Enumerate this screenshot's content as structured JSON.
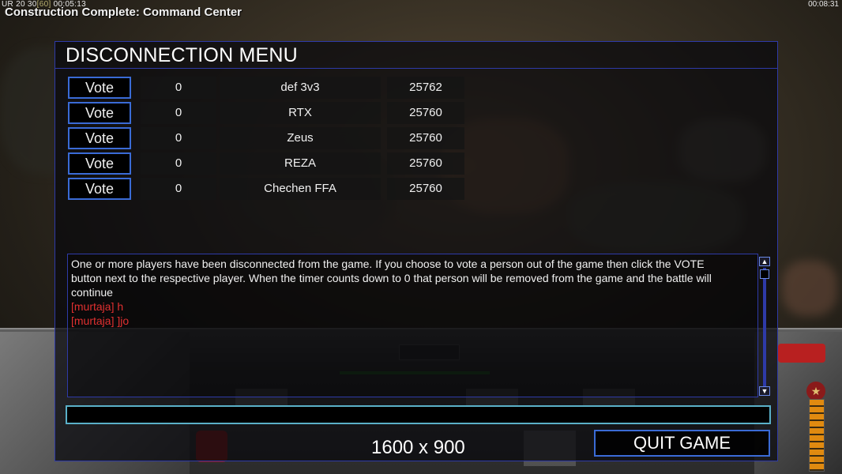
{
  "hud": {
    "stats_prefix": "UR 20 30",
    "stats_bracket": "[60]",
    "stats_time": "00:05:13",
    "notification": "Construction Complete: Command Center",
    "clock": "00:08:31"
  },
  "menu": {
    "title": "DISCONNECTION MENU",
    "vote_label": "Vote",
    "players": [
      {
        "count": "0",
        "name": "def 3v3",
        "port": "25762"
      },
      {
        "count": "0",
        "name": "RTX",
        "port": "25760"
      },
      {
        "count": "0",
        "name": "Zeus",
        "port": "25760"
      },
      {
        "count": "0",
        "name": "REZA",
        "port": "25760"
      },
      {
        "count": "0",
        "name": "Chechen FFA",
        "port": "25760"
      }
    ],
    "info_line1": "One or more players have been disconnected from the game. If you choose to vote a person out of the game then click the VOTE",
    "info_line2": " button next to the respective player. When the timer counts down to 0 that person will be removed from the game and the battle will",
    "info_line3": "continue",
    "messages": [
      "[murtaja] h",
      "[murtaja] ]jo"
    ],
    "chat_input_value": "",
    "resolution": "1600 x 900",
    "quit_label": "QUIT GAME"
  },
  "colors": {
    "panel_border": "#2e3aa8",
    "button_border": "#3a6bd6",
    "input_border": "#5ab0c8",
    "chat_message": "#e03030"
  },
  "icons": {
    "scroll_up": "triangle-up-icon",
    "scroll_down": "triangle-down-icon",
    "rank": "star-icon"
  }
}
